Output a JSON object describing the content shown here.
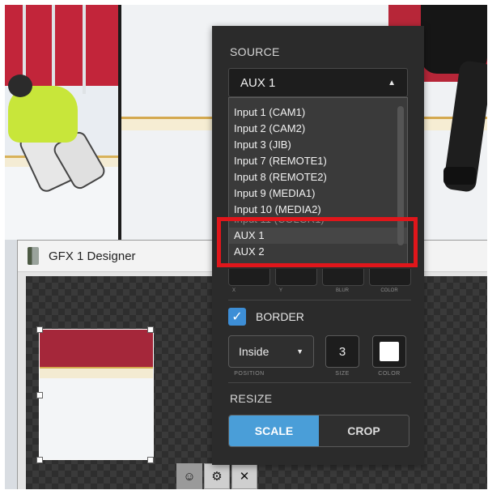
{
  "source": {
    "section_label": "SOURCE",
    "selected": "AUX 1",
    "options": [
      "Input 1 (CAM1)",
      "Input 2 (CAM2)",
      "Input 3 (JIB)",
      "Input 7 (REMOTE1)",
      "Input 8 (REMOTE2)",
      "Input 9 (MEDIA1)",
      "Input 10 (MEDIA2)",
      "Input 11 (COLOR1)",
      "AUX 1",
      "AUX 2"
    ]
  },
  "shadow": {
    "labels": [
      "X",
      "Y",
      "BLUR",
      "COLOR"
    ]
  },
  "border": {
    "label": "BORDER",
    "checked": true,
    "position_value": "Inside",
    "size_value": "3",
    "color": "#ffffff",
    "position_label": "POSITION",
    "size_label": "SIZE",
    "color_label": "COLOR"
  },
  "resize": {
    "section_label": "RESIZE",
    "options": [
      "SCALE",
      "CROP"
    ],
    "selected": "SCALE"
  },
  "gfx_window": {
    "title": "GFX 1 Designer"
  },
  "colors": {
    "accent": "#4a9ed8",
    "highlight": "#e0161b",
    "panel_bg": "#2b2b2b"
  }
}
